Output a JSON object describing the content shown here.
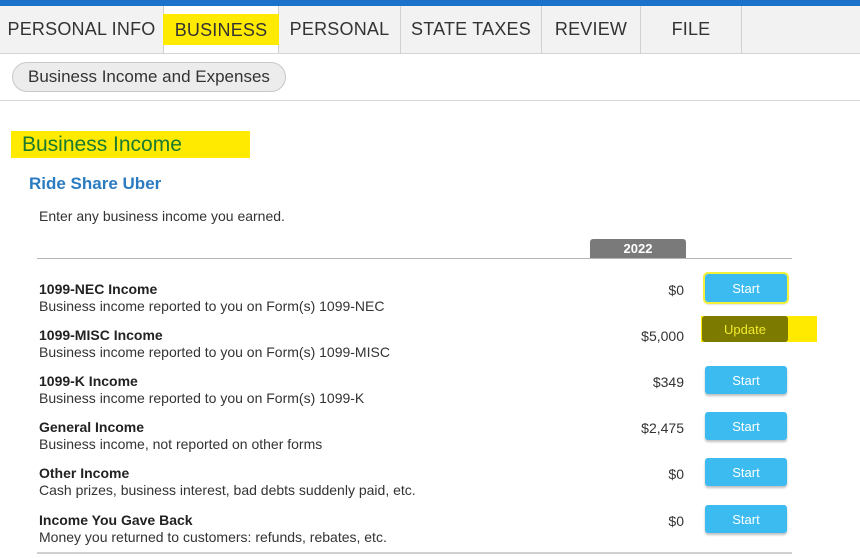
{
  "nav": {
    "tabs": [
      {
        "label": "PERSONAL INFO",
        "active": false
      },
      {
        "label": "BUSINESS",
        "active": true
      },
      {
        "label": "PERSONAL",
        "active": false
      },
      {
        "label": "STATE TAXES",
        "active": false
      },
      {
        "label": "REVIEW",
        "active": false
      },
      {
        "label": "FILE",
        "active": false
      }
    ]
  },
  "subnav": {
    "pill_label": "Business Income and Expenses"
  },
  "section": {
    "title": "Business Income",
    "business_name": "Ride Share Uber",
    "intro": "Enter any business income you earned.",
    "year": "2022"
  },
  "rows": [
    {
      "title": "1099-NEC Income",
      "desc": "Business income reported to you on Form(s) 1099-NEC",
      "amount": "$0",
      "button": "Start"
    },
    {
      "title": "1099-MISC Income",
      "desc": "Business income reported to you on Form(s) 1099-MISC",
      "amount": "$5,000",
      "button": "Update"
    },
    {
      "title": "1099-K Income",
      "desc": "Business income reported to you on Form(s) 1099-K",
      "amount": "$349",
      "button": "Start"
    },
    {
      "title": "General Income",
      "desc": "Business income, not reported on other forms",
      "amount": "$2,475",
      "button": "Start"
    },
    {
      "title": "Other Income",
      "desc": "Cash prizes, business interest, bad debts suddenly paid, etc.",
      "amount": "$0",
      "button": "Start"
    },
    {
      "title": "Income You Gave Back",
      "desc": "Money you returned to customers: refunds, rebates, etc.",
      "amount": "$0",
      "button": "Start"
    }
  ],
  "colors": {
    "accent": "#1a73c8",
    "highlight": "#ffea00",
    "button": "#3cbbf0",
    "section_title": "#1b7a2f",
    "business_name": "#2b7bc1"
  }
}
